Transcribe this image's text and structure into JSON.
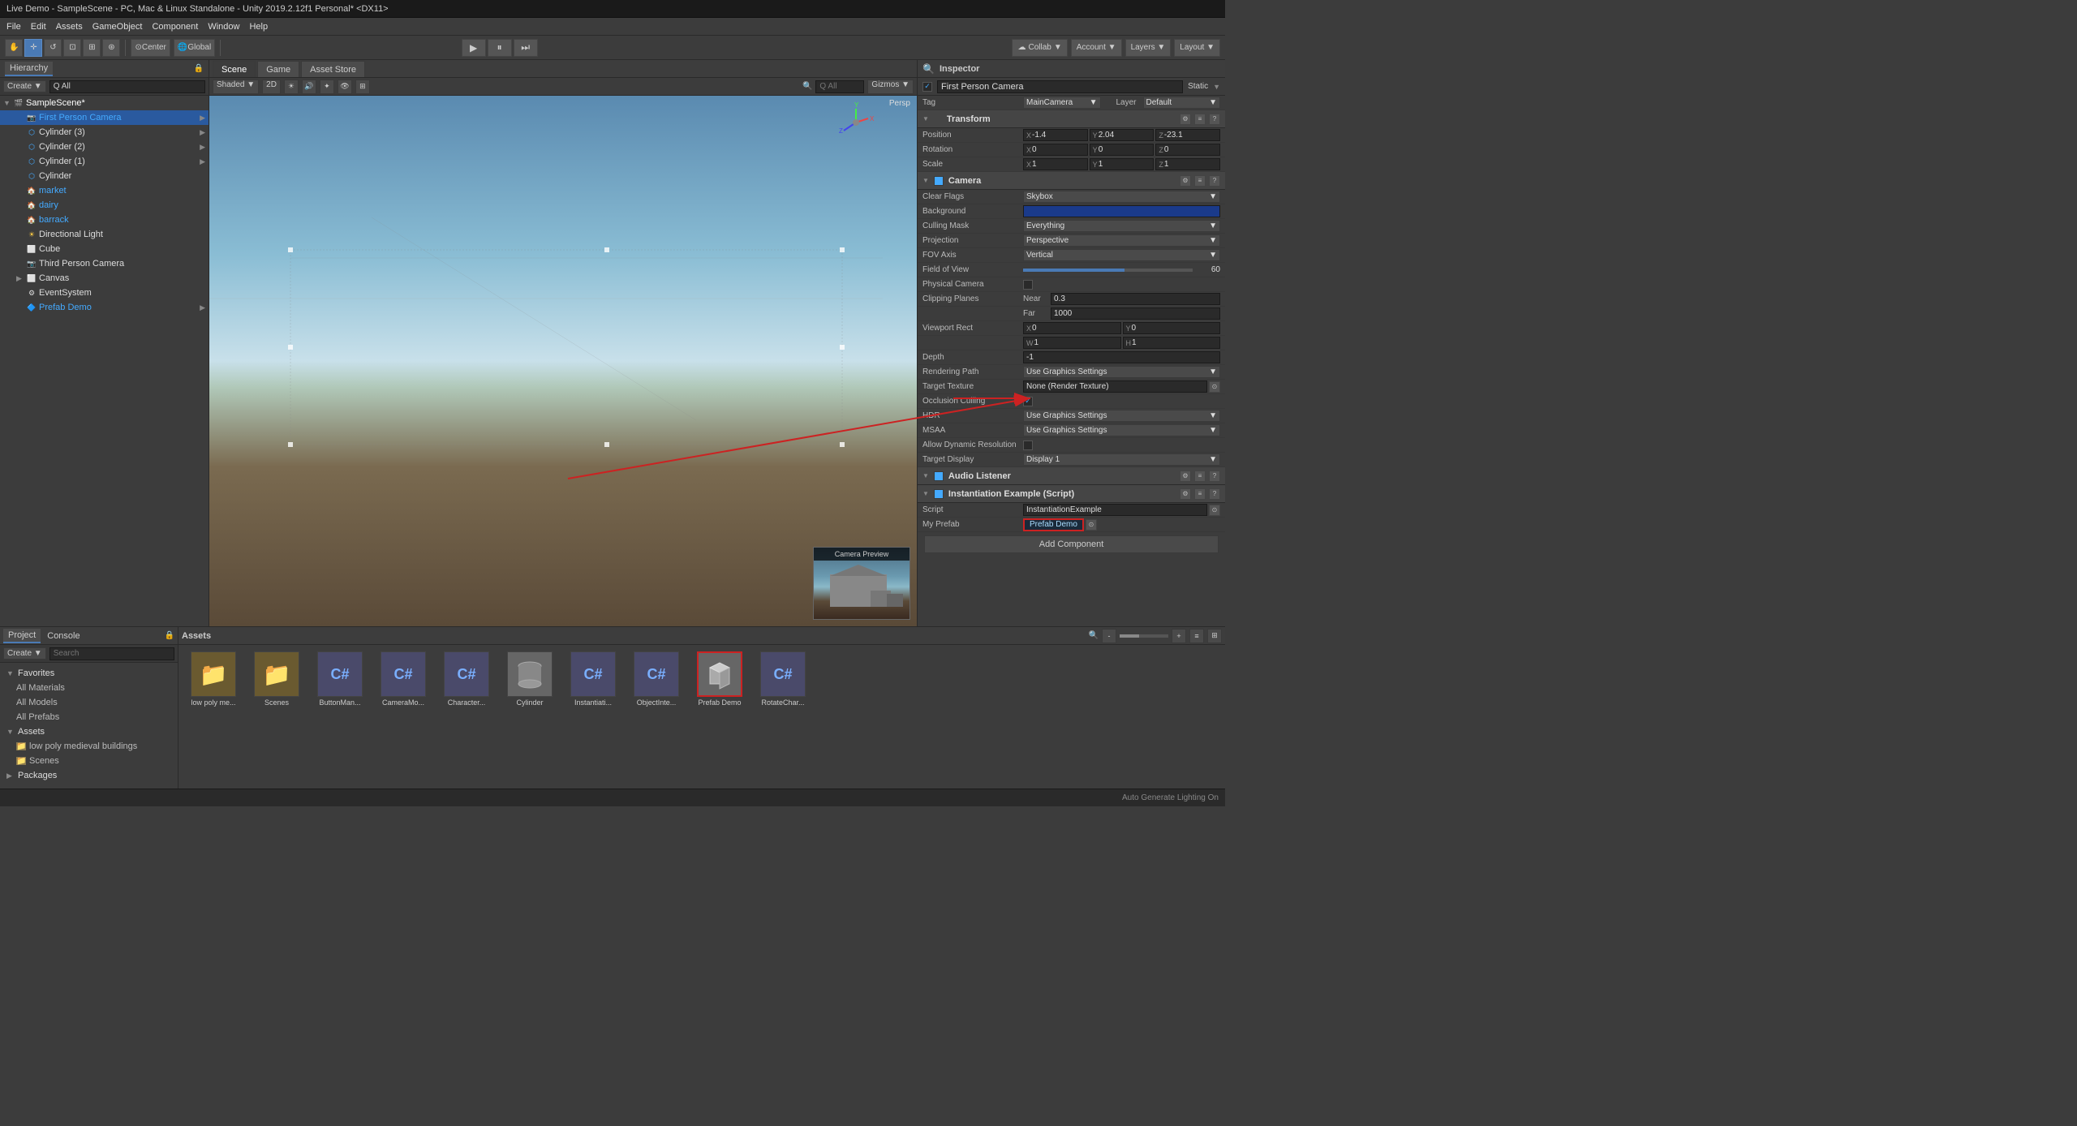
{
  "window": {
    "title": "Live Demo - SampleScene - PC, Mac & Linux Standalone - Unity 2019.2.12f1 Personal* <DX11>"
  },
  "menu": {
    "items": [
      "File",
      "Edit",
      "Assets",
      "GameObject",
      "Component",
      "Window",
      "Help"
    ]
  },
  "toolbar": {
    "transform_tools": [
      "⊕",
      "✛",
      "↺",
      "⊡",
      "⊞",
      "⊛"
    ],
    "pivot_mode": "Center",
    "pivot_space": "Global",
    "play": "▶",
    "pause": "⏸",
    "step": "⏭",
    "collab": "Collab ▼",
    "account": "Account ▼",
    "layers": "Layers ▼",
    "layout": "Layout ▼"
  },
  "hierarchy": {
    "tab": "Hierarchy",
    "create_btn": "Create ▼",
    "search_placeholder": "Q All",
    "items": [
      {
        "id": "sample-scene",
        "label": "SampleScene*",
        "indent": 0,
        "type": "scene",
        "expanded": true
      },
      {
        "id": "first-person-camera",
        "label": "First Person Camera",
        "indent": 1,
        "type": "prefab",
        "selected": true
      },
      {
        "id": "cylinder3",
        "label": "Cylinder (3)",
        "indent": 1,
        "type": "go"
      },
      {
        "id": "cylinder2",
        "label": "Cylinder (2)",
        "indent": 1,
        "type": "go"
      },
      {
        "id": "cylinder1",
        "label": "Cylinder (1)",
        "indent": 1,
        "type": "go"
      },
      {
        "id": "cylinder",
        "label": "Cylinder",
        "indent": 1,
        "type": "go"
      },
      {
        "id": "market",
        "label": "market",
        "indent": 1,
        "type": "prefab"
      },
      {
        "id": "dairy",
        "label": "dairy",
        "indent": 1,
        "type": "prefab"
      },
      {
        "id": "barrack",
        "label": "barrack",
        "indent": 1,
        "type": "prefab"
      },
      {
        "id": "directional-light",
        "label": "Directional Light",
        "indent": 1,
        "type": "go"
      },
      {
        "id": "cube",
        "label": "Cube",
        "indent": 1,
        "type": "go"
      },
      {
        "id": "third-person-camera",
        "label": "Third Person Camera",
        "indent": 1,
        "type": "go"
      },
      {
        "id": "canvas",
        "label": "Canvas",
        "indent": 1,
        "type": "go",
        "expanded": true
      },
      {
        "id": "event-system",
        "label": "EventSystem",
        "indent": 1,
        "type": "go"
      },
      {
        "id": "prefab-demo",
        "label": "Prefab Demo",
        "indent": 1,
        "type": "prefab",
        "has_arrow": true
      }
    ]
  },
  "scene_view": {
    "tabs": [
      "Scene",
      "Game",
      "Asset Store"
    ],
    "active_tab": "Scene",
    "shading_mode": "Shaded",
    "dimension": "2D",
    "gizmo_label": "Gizmos ▼",
    "all_label": "Q All",
    "persp_label": "Persp"
  },
  "inspector": {
    "title": "Inspector",
    "gameobject_name": "First Person Camera",
    "static_label": "Static",
    "tag_label": "Tag",
    "tag_value": "MainCamera",
    "layer_label": "Layer",
    "layer_value": "Default",
    "transform": {
      "title": "Transform",
      "position_label": "Position",
      "position_x": "X -1.4",
      "position_y": "Y 2.04",
      "position_z": "Z -23.1",
      "rotation_label": "Rotation",
      "rotation_x": "X 0",
      "rotation_y": "Y 0",
      "rotation_z": "Z 0",
      "scale_label": "Scale",
      "scale_x": "X 1",
      "scale_y": "Y 1",
      "scale_z": "Z 1"
    },
    "camera": {
      "title": "Camera",
      "clear_flags_label": "Clear Flags",
      "clear_flags_value": "Skybox",
      "background_label": "Background",
      "culling_mask_label": "Culling Mask",
      "culling_mask_value": "Everything",
      "projection_label": "Projection",
      "projection_value": "Perspective",
      "fov_axis_label": "FOV Axis",
      "fov_axis_value": "Vertical",
      "field_of_view_label": "Field of View",
      "field_of_view_value": "60",
      "physical_camera_label": "Physical Camera",
      "clipping_planes_label": "Clipping Planes",
      "near_label": "Near",
      "near_value": "0.3",
      "far_label": "Far",
      "far_value": "1000",
      "viewport_rect_label": "Viewport Rect",
      "vp_x": "X 0",
      "vp_y": "Y 0",
      "vp_w": "W 1",
      "vp_h": "H 1",
      "depth_label": "Depth",
      "depth_value": "-1",
      "rendering_path_label": "Rendering Path",
      "rendering_path_value": "Use Graphics Settings",
      "target_texture_label": "Target Texture",
      "target_texture_value": "None (Render Texture)",
      "occlusion_culling_label": "Occlusion Culling",
      "hdr_label": "HDR",
      "hdr_value": "Use Graphics Settings",
      "msaa_label": "MSAA",
      "msaa_value": "Use Graphics Settings",
      "allow_dynamic_res_label": "Allow Dynamic Resolution",
      "target_display_label": "Target Display",
      "target_display_value": "Display 1"
    },
    "audio_listener": {
      "title": "Audio Listener"
    },
    "instantiation_script": {
      "title": "Instantiation Example (Script)",
      "script_label": "Script",
      "script_value": "InstantiationExample",
      "my_prefab_label": "My Prefab",
      "my_prefab_source": "My Prefab",
      "my_prefab_value": "Prefab Demo"
    },
    "add_component_btn": "Add Component"
  },
  "project": {
    "tabs": [
      "Project",
      "Console"
    ],
    "active_tab": "Project",
    "create_btn": "Create ▼",
    "favorites": {
      "label": "Favorites",
      "items": [
        "All Materials",
        "All Models",
        "All Prefabs"
      ]
    },
    "assets": {
      "label": "Assets",
      "items": [
        "low poly medieval buildings",
        "Scenes"
      ]
    },
    "packages": {
      "label": "Packages"
    }
  },
  "assets_panel": {
    "title": "Assets",
    "items": [
      {
        "id": "low-poly-me",
        "label": "low poly me...",
        "type": "folder"
      },
      {
        "id": "scenes",
        "label": "Scenes",
        "type": "folder"
      },
      {
        "id": "buttonman",
        "label": "ButtonMan...",
        "type": "cs"
      },
      {
        "id": "cameramo",
        "label": "CameraMo...",
        "type": "cs"
      },
      {
        "id": "character",
        "label": "Character...",
        "type": "cs"
      },
      {
        "id": "cylinder",
        "label": "Cylinder",
        "type": "mesh"
      },
      {
        "id": "instantiati",
        "label": "Instantiati...",
        "type": "cs"
      },
      {
        "id": "objectinte",
        "label": "ObjectInte...",
        "type": "cs"
      },
      {
        "id": "prefab-demo",
        "label": "Prefab Demo",
        "type": "prefab",
        "selected": true
      },
      {
        "id": "rotatechar",
        "label": "RotateChar...",
        "type": "cs"
      }
    ]
  },
  "status_bar": {
    "text": "Auto Generate Lighting On"
  }
}
